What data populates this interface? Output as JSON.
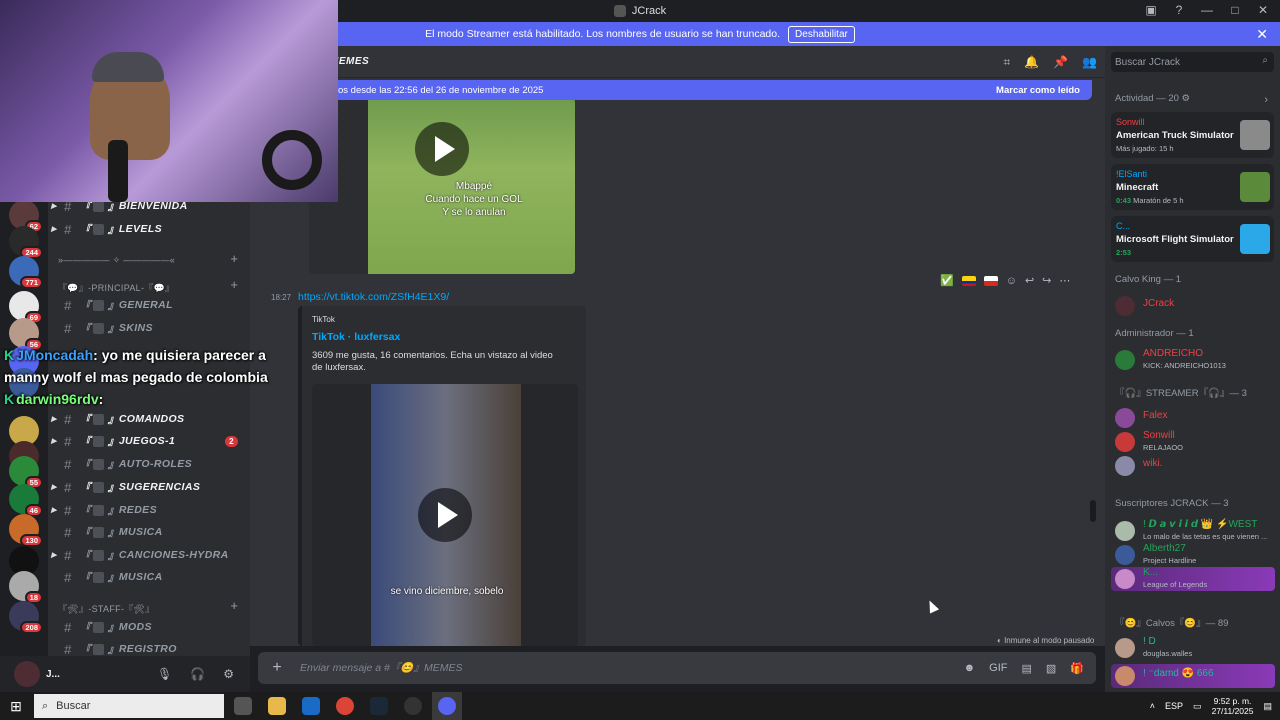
{
  "window": {
    "title": "JCrack"
  },
  "banner": {
    "text": "El modo Streamer está habilitado. Los nombres de usuario se han truncado.",
    "button": "Deshabilitar"
  },
  "servers": [
    {
      "badge": "62",
      "color": "#5a3a3a"
    },
    {
      "badge": "244",
      "color": "#2a2a2a"
    },
    {
      "badge": "771",
      "color": "#3a6ab8"
    },
    {
      "badge": "69",
      "color": "#e8e8e8"
    },
    {
      "badge": "56",
      "color": "#b89a8a"
    },
    {
      "badge": "",
      "color": "#5865f2"
    },
    {
      "badge": "",
      "color": "#3a5a9a"
    },
    {
      "badge": "",
      "color": "#c8a848"
    },
    {
      "badge": "",
      "color": "#4a2a2a"
    },
    {
      "badge": "55",
      "color": "#2a8a3a"
    },
    {
      "badge": "46",
      "color": "#1a7a3a"
    },
    {
      "badge": "130",
      "color": "#c86a2a"
    },
    {
      "badge": "",
      "color": "#111111"
    },
    {
      "badge": "18",
      "color": "#aaaaaa"
    },
    {
      "badge": "208",
      "color": "#3a3a5a"
    }
  ],
  "new_badge": "NUEVO",
  "channels": {
    "items": [
      {
        "name": "BIENVENIDA",
        "caret": "▶",
        "emoji": "🤍",
        "bright": true
      },
      {
        "name": "LEVELS",
        "caret": "▶",
        "emoji": "📈",
        "bright": true
      },
      {
        "name": "GENERAL",
        "caret": "",
        "emoji": "💬",
        "bright": false
      },
      {
        "name": "SKINS",
        "caret": "",
        "emoji": "😊",
        "bright": false
      },
      {
        "name": "COMANDOS",
        "caret": "▶",
        "emoji": "🛡",
        "bright": true
      },
      {
        "name": "JUEGOS-1",
        "caret": "▶",
        "emoji": "🎮",
        "bright": true,
        "badge": "2"
      },
      {
        "name": "AUTO-ROLES",
        "caret": "",
        "emoji": "🔘",
        "bright": false
      },
      {
        "name": "SUGERENCIAS",
        "caret": "▶",
        "emoji": "📩",
        "bright": true
      },
      {
        "name": "REDES",
        "caret": "▶",
        "emoji": "🌐",
        "bright": false
      },
      {
        "name": "MUSICA",
        "caret": "",
        "emoji": "🎵",
        "bright": false
      },
      {
        "name": "CANCIONES-HYDRA",
        "caret": "▶",
        "emoji": "🎶",
        "bright": false
      },
      {
        "name": "MUSICA",
        "caret": "",
        "emoji": "🎶",
        "bright": false
      },
      {
        "name": "MODS",
        "caret": "",
        "emoji": "🛠",
        "bright": false
      },
      {
        "name": "REGISTRO",
        "caret": "",
        "emoji": "📋",
        "bright": false
      }
    ],
    "cat_divider": "»————— ✧ —————«",
    "cat_principal": "『💬』-PRINCIPAL-『💬』",
    "cat_staff": "『🛠』-STAFF-『🛠』"
  },
  "user_panel": {
    "name": "J..."
  },
  "header": {
    "channel": "MEMES"
  },
  "new_messages": {
    "left": "os desde las 22:56 del 26 de noviembre de 2025",
    "right": "Marcar como leído"
  },
  "message1": {
    "caption": "Mbappé\nCuando hace un GOL\nY se lo anulan"
  },
  "message2": {
    "time": "18:27",
    "link": "https://vt.tiktok.com/ZSfH4E1X9/",
    "provider": "TikTok",
    "title": "TikTok · luxfersax",
    "description": "3609 me gusta, 16 comentarios. Echa un vistazo al video de luxfersax.",
    "caption": "se vino diciembre, sobelo"
  },
  "paused_label": "Inmune al modo pausado",
  "composer": {
    "placeholder": "Enviar mensaje a #『😊』MEMES"
  },
  "members": {
    "search_placeholder": "Buscar JCrack",
    "activity_header": "Actividad — 20",
    "activities": [
      {
        "user": "Sonwill",
        "game": "American Truck Simulator",
        "sub": "Más jugado: 15 h",
        "time": "",
        "img": "#8a8a8a"
      },
      {
        "user": "!ElSanti",
        "game": "Minecraft",
        "sub": "Maratón de 5 h",
        "time": "0:43",
        "img": "#5a8a3a"
      },
      {
        "user": "C...",
        "game": "Microsoft Flight Simulator ...",
        "sub": "",
        "time": "2:53",
        "img": "#2aa8e8"
      }
    ],
    "groups": [
      {
        "header": "Calvo King — 1",
        "members": [
          {
            "name": "JCrack",
            "sub": "",
            "color": "#f23f43",
            "av": "#4e2c33"
          }
        ]
      },
      {
        "header": "Administrador — 1",
        "members": [
          {
            "name": "ANDREICHO",
            "sub": "KICK: ANDREICHO1013",
            "color": "#f23f43",
            "av": "#2a7a3a"
          }
        ]
      },
      {
        "header": "『🎧』STREAMER『🎧』— 3",
        "members": [
          {
            "name": "Falex",
            "sub": "",
            "color": "#f23f43",
            "av": "#8a4a9a"
          },
          {
            "name": "Sonwill",
            "sub": "RELAJAOO",
            "color": "#f23f43",
            "av": "#c83a3a"
          },
          {
            "name": "wiki.",
            "sub": "",
            "color": "#f23f43",
            "av": "#8a8aa8"
          }
        ]
      },
      {
        "header": "Suscriptores JCRACK — 3",
        "members": [
          {
            "name": "! 𝘿 𝙖 𝙫 𝙞 𝙞 𝙙 👑 ⚡WEST",
            "sub": "Lo malo de las tetas es que vienen ...",
            "color": "#23a55a",
            "av": "#aabbaa"
          },
          {
            "name": "Alberth27",
            "sub": "Project Hardline",
            "color": "#23a55a",
            "av": "#3a5a9a"
          },
          {
            "name": "K...",
            "sub": "League of Legends",
            "color": "#23a55a",
            "av": "#c88ac8",
            "highlight": true
          }
        ]
      },
      {
        "header": "『😊』Calvos『😊』— 89",
        "members": [
          {
            "name": "! D",
            "sub": "douglas.walles",
            "color": "#1abc9c",
            "av": "#b89a8a"
          },
          {
            "name": "! ⁻damd 😍 666",
            "sub": "",
            "color": "#1abc9c",
            "av": "#c88a6a",
            "highlight": true
          }
        ]
      }
    ]
  },
  "chat_overlay": {
    "line1_user": "JMoncadah",
    "line1_text": ": yo me quisiera parecer a",
    "line2_text": "manny wolf el mas pegado de colombia",
    "line3_user": "darwin96rdv",
    "line3_text": ":"
  },
  "taskbar": {
    "search": "Buscar",
    "lang": "ESP",
    "time": "9:52 p. m.",
    "date": "27/11/2025"
  }
}
